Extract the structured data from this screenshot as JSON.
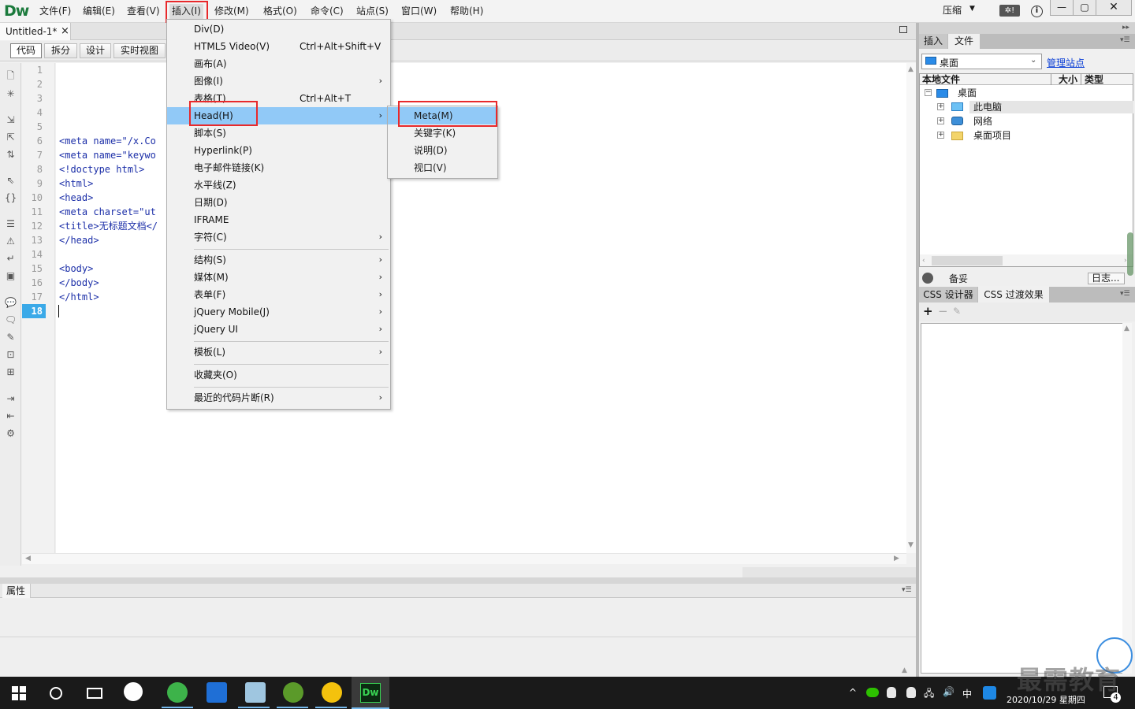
{
  "app": {
    "logo": "Dw"
  },
  "menubar": {
    "items": [
      "文件(F)",
      "编辑(E)",
      "查看(V)",
      "插入(I)",
      "修改(M)",
      "格式(O)",
      "命令(C)",
      "站点(S)",
      "窗口(W)",
      "帮助(H)"
    ],
    "compress_label": "压缩",
    "help_glyph": "i",
    "window_buttons": {
      "minimize": "—",
      "maximize": "▢",
      "close": "✕"
    }
  },
  "doc_tab": {
    "title": "Untitled-1*",
    "close": "×"
  },
  "view_toolbar": {
    "buttons": [
      "代码",
      "拆分",
      "设计",
      "实时视图"
    ],
    "active": "代码"
  },
  "editor": {
    "line_numbers": [
      "1",
      "2",
      "3",
      "4",
      "5",
      "6",
      "7",
      "8",
      "9",
      "10",
      "11",
      "12",
      "13",
      "14",
      "15",
      "16",
      "17",
      "18"
    ],
    "current_line": "18",
    "lines": [
      "",
      "",
      "",
      "",
      "",
      "<meta name=\"/x.Co",
      "<meta name=\"keywo",
      "<!doctype html>",
      "<html>",
      "<head>",
      "<meta charset=\"ut",
      "<title>无标题文档</",
      "</head>",
      "",
      "<body>",
      "</body>",
      "</html>",
      ""
    ]
  },
  "properties_panel": {
    "tab": "属性"
  },
  "insert_menu": {
    "items": [
      {
        "label": "Div(D)",
        "shortcut": "",
        "submenu": false
      },
      {
        "label": "HTML5 Video(V)",
        "shortcut": "Ctrl+Alt+Shift+V",
        "submenu": false
      },
      {
        "label": "画布(A)",
        "shortcut": "",
        "submenu": false
      },
      {
        "label": "图像(I)",
        "shortcut": "",
        "submenu": true
      },
      {
        "label": "表格(T)",
        "shortcut": "Ctrl+Alt+T",
        "submenu": false
      },
      {
        "label": "Head(H)",
        "shortcut": "",
        "submenu": true,
        "highlighted": true
      },
      {
        "label": "脚本(S)",
        "shortcut": "",
        "submenu": false
      },
      {
        "label": "Hyperlink(P)",
        "shortcut": "",
        "submenu": false
      },
      {
        "label": "电子邮件链接(K)",
        "shortcut": "",
        "submenu": false
      },
      {
        "label": "水平线(Z)",
        "shortcut": "",
        "submenu": false
      },
      {
        "label": "日期(D)",
        "shortcut": "",
        "submenu": false
      },
      {
        "label": "IFRAME",
        "shortcut": "",
        "submenu": false
      },
      {
        "label": "字符(C)",
        "shortcut": "",
        "submenu": true
      },
      {
        "label": "结构(S)",
        "shortcut": "",
        "submenu": true
      },
      {
        "label": "媒体(M)",
        "shortcut": "",
        "submenu": true
      },
      {
        "label": "表单(F)",
        "shortcut": "",
        "submenu": true
      },
      {
        "label": "jQuery Mobile(J)",
        "shortcut": "",
        "submenu": true
      },
      {
        "label": "jQuery UI",
        "shortcut": "",
        "submenu": true
      },
      {
        "label": "模板(L)",
        "shortcut": "",
        "submenu": true
      },
      {
        "label": "收藏夹(O)",
        "shortcut": "",
        "submenu": false
      },
      {
        "label": "最近的代码片断(R)",
        "shortcut": "",
        "submenu": true
      }
    ],
    "arrow": "›"
  },
  "head_submenu": {
    "items": [
      "Meta(M)",
      "关键字(K)",
      "说明(D)",
      "视口(V)"
    ],
    "highlighted": "Meta(M)"
  },
  "files_panel": {
    "tabs": [
      "插入",
      "文件"
    ],
    "active_tab": "文件",
    "site_select": "桌面",
    "manage_link": "管理站点",
    "columns": [
      "本地文件",
      "大小",
      "类型"
    ],
    "tree": {
      "root": "桌面",
      "children": [
        "此电脑",
        "网络",
        "桌面项目"
      ]
    },
    "status_text": "备妥",
    "log_button": "日志..."
  },
  "css_panel": {
    "tabs": [
      "CSS 设计器",
      "CSS 过渡效果"
    ],
    "active_tab": "CSS 过渡效果",
    "add": "+",
    "remove": "−"
  },
  "taskbar": {
    "ime": "中",
    "date": "2020/10/29 星期四",
    "notification_count": "4"
  },
  "watermark": "最需教育",
  "colors": {
    "menu_highlight": "#91c9f7",
    "annotation_red": "#e8292b",
    "code_blue": "#1c2fa8",
    "current_line": "#3aa9e8",
    "link_blue": "#0b3fd6"
  }
}
